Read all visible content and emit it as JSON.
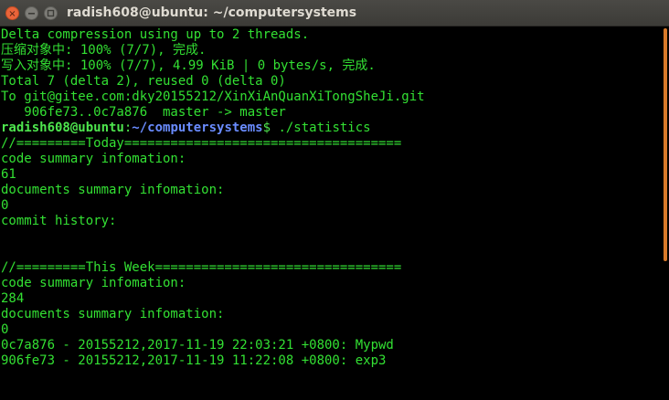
{
  "window": {
    "title": "radish608@ubuntu: ~/computersystems",
    "close_glyph": "×"
  },
  "terminal": {
    "lines_before_prompt": [
      "Delta compression using up to 2 threads.",
      "压缩对象中: 100% (7/7), 完成.",
      "写入对象中: 100% (7/7), 4.99 KiB | 0 bytes/s, 完成.",
      "Total 7 (delta 2), reused 0 (delta 0)",
      "To git@gitee.com:dky20155212/XinXiAnQuanXiTongSheJi.git",
      "   906fe73..0c7a876  master -> master"
    ],
    "prompt": {
      "user_host": "radish608@ubuntu",
      "separator": ":",
      "path": "~/computersystems",
      "dollar": "$ ",
      "command": "./statistics"
    },
    "lines_after_prompt": [
      "//=========Today====================================",
      "code summary infomation:",
      "61",
      "documents summary infomation:",
      "0",
      "commit history:",
      "",
      "",
      "//=========This Week================================",
      "code summary infomation:",
      "284",
      "documents summary infomation:",
      "0",
      "0c7a876 - 20155212,2017-11-19 22:03:21 +0800: Mypwd",
      "906fe73 - 20155212,2017-11-19 11:22:08 +0800: exp3"
    ]
  },
  "colors": {
    "background": "#000000",
    "text": "#33e033",
    "prompt_path": "#6a8cff",
    "close_button": "#e9643a",
    "scrollbar_thumb": "#d97a2a"
  }
}
